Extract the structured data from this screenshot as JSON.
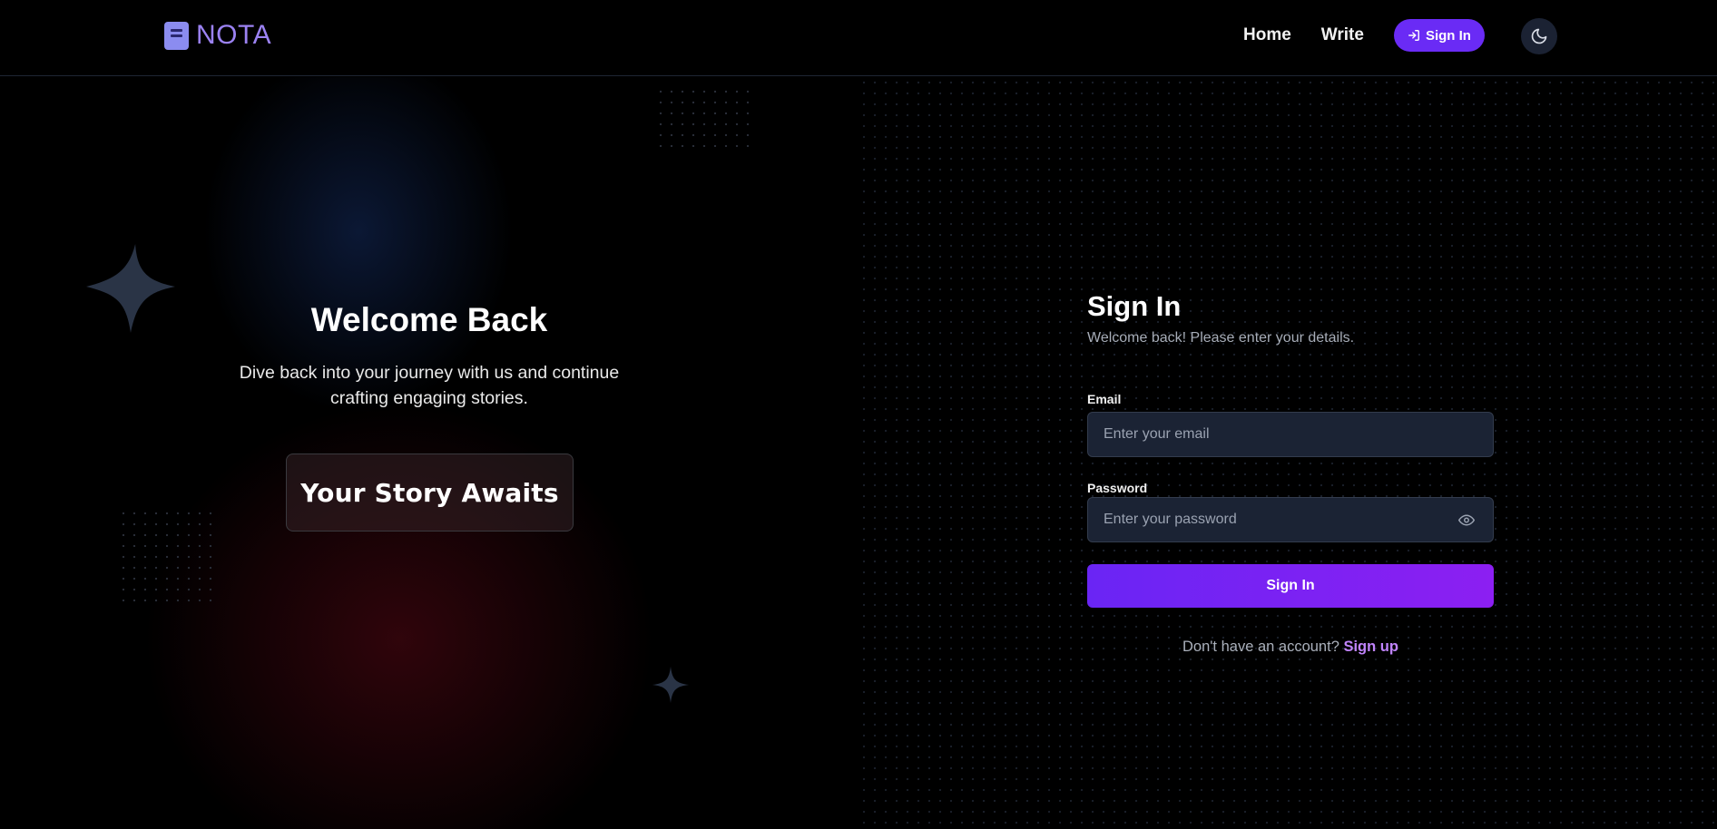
{
  "header": {
    "logo_text": "NOTA",
    "logo_icon": "book-icon",
    "nav": {
      "home_label": "Home",
      "write_label": "Write",
      "signin_label": "Sign In",
      "signin_icon": "login-arrow-icon"
    },
    "theme_toggle_icon": "moon-icon"
  },
  "hero": {
    "title": "Welcome Back",
    "subtitle": "Dive back into your journey with us and continue crafting engaging stories.",
    "badge_text": "Your Story Awaits"
  },
  "form": {
    "title": "Sign In",
    "subtitle": "Welcome back! Please enter your details.",
    "email": {
      "label": "Email",
      "placeholder": "Enter your email",
      "value": ""
    },
    "password": {
      "label": "Password",
      "placeholder": "Enter your password",
      "value": "",
      "toggle_icon": "eye-icon"
    },
    "submit_label": "Sign In",
    "signup_prompt": "Don't have an account?",
    "signup_link": "Sign up"
  },
  "colors": {
    "accent": "#6a2bf5",
    "accent_light": "#c084fc",
    "logo": "#9b82f2",
    "input_bg": "#1b2334",
    "background": "#000000"
  }
}
